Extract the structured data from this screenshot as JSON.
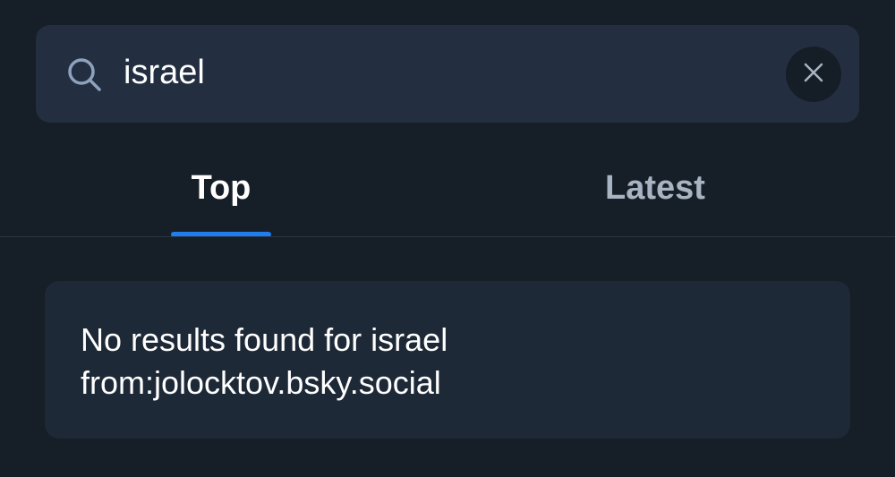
{
  "search": {
    "query": "israel",
    "search_icon": "search-icon",
    "clear_icon": "close-icon"
  },
  "tabs": [
    {
      "label": "Top",
      "selected": true
    },
    {
      "label": "Latest",
      "selected": false
    }
  ],
  "results": {
    "empty_message_line1": "No results found for israel",
    "empty_message_line2": "from:jolocktov.bsky.social"
  },
  "colors": {
    "background": "#161e27",
    "search_bar": "#232f40",
    "accent": "#1f7df0",
    "card": "#1e2937",
    "inactive_tab": "#a9b4c3"
  }
}
